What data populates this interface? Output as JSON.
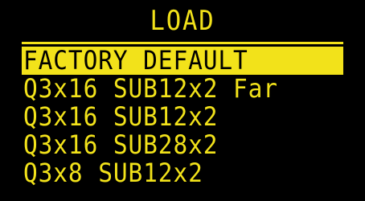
{
  "menu": {
    "title": "LOAD",
    "items": [
      {
        "label": "FACTORY DEFAULT",
        "selected": true
      },
      {
        "label": "Q3x16 SUB12x2 Far",
        "selected": false
      },
      {
        "label": "Q3x16 SUB12x2",
        "selected": false
      },
      {
        "label": "Q3x16 SUB28x2",
        "selected": false
      },
      {
        "label": "Q3x8 SUB12x2",
        "selected": false
      }
    ]
  },
  "colors": {
    "background": "#000000",
    "accent": "#f2e21a",
    "selected_text": "#000000"
  }
}
